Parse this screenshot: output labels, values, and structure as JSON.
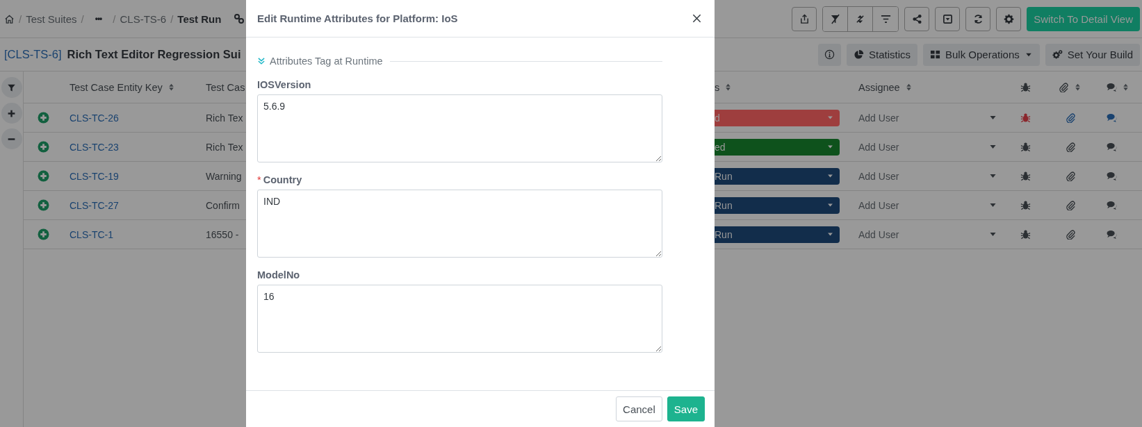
{
  "breadcrumb": [
    {
      "kind": "home"
    },
    {
      "kind": "sep",
      "label": "/"
    },
    {
      "kind": "link",
      "label": "Test Suites"
    },
    {
      "kind": "sep",
      "label": "/"
    },
    {
      "kind": "more",
      "label": "•••"
    },
    {
      "kind": "sep",
      "label": "/"
    },
    {
      "kind": "link",
      "label": "CLS-TS-6"
    },
    {
      "kind": "sep",
      "label": "/"
    },
    {
      "kind": "current",
      "label": "Test Run"
    },
    {
      "kind": "copy-link"
    }
  ],
  "toolbar": {
    "primary_button": "Switch To Detail View"
  },
  "suite": {
    "key": "[CLS-TS-6]",
    "title": "Rich Text Editor Regression Sui"
  },
  "actions": [
    {
      "kind": "info"
    },
    {
      "kind": "statistics",
      "label": "Statistics"
    },
    {
      "kind": "bulk",
      "label": "Bulk Operations"
    },
    {
      "kind": "build",
      "label": "Set Your Build"
    }
  ],
  "table": {
    "columns": [
      "Test Case Entity Key",
      "Test Cas",
      "s",
      "Assignee"
    ],
    "rows": [
      {
        "key": "CLS-TC-26",
        "title": "Rich Tex",
        "status": "d",
        "color": "#9e3e3e",
        "assignee": "Add User",
        "bug_active": true,
        "attachment_active": true,
        "comment_active": true
      },
      {
        "key": "CLS-TC-23",
        "title": "Rich Tex",
        "status": "ed",
        "color": "#0e521c",
        "assignee": "Add User",
        "bug_active": false,
        "attachment_active": false,
        "comment_active": false
      },
      {
        "key": "CLS-TC-19",
        "title": "Warning",
        "status": "Run",
        "color": "#122d4b",
        "assignee": "Add User",
        "bug_active": false,
        "attachment_active": false,
        "comment_active": false
      },
      {
        "key": "CLS-TC-27",
        "title": "Confirm",
        "status": "Run",
        "color": "#122d4b",
        "assignee": "Add User",
        "bug_active": false,
        "attachment_active": false,
        "comment_active": false
      },
      {
        "key": "CLS-TC-1",
        "title": "16550 -",
        "status": "Run",
        "color": "#122d4b",
        "assignee": "Add User",
        "bug_active": false,
        "attachment_active": false,
        "comment_active": false
      }
    ]
  },
  "modal": {
    "title": "Edit Runtime Attributes for Platform: IoS",
    "section": "Attributes Tag at Runtime",
    "fields": [
      {
        "label": "IOSVersion",
        "required": false,
        "value": "5.6.9"
      },
      {
        "label": "Country",
        "required": true,
        "marker": "*",
        "value": "IND"
      },
      {
        "label": "ModelNo",
        "required": false,
        "value": "16"
      }
    ],
    "buttons": [
      {
        "kind": "secondary",
        "label": "Cancel"
      },
      {
        "kind": "primary",
        "label": "Save"
      }
    ]
  }
}
